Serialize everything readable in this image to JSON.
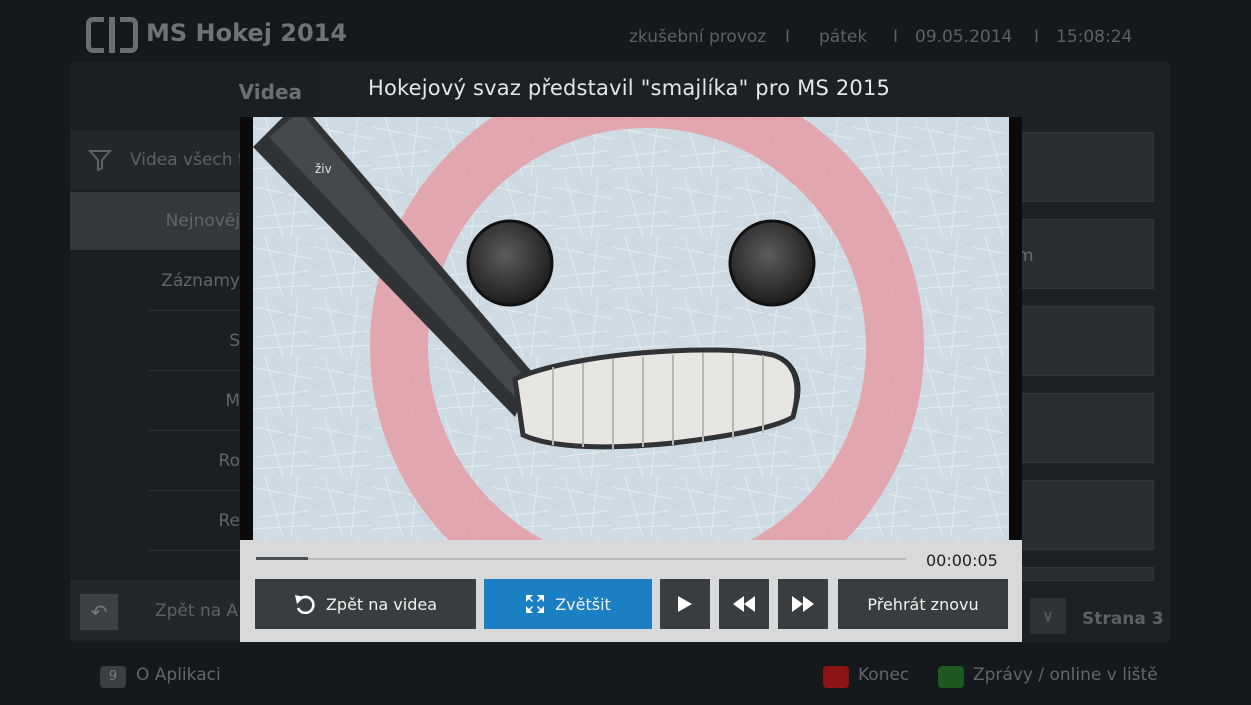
{
  "header": {
    "app_title": "MS Hokej 2014",
    "mode": "zkušební provoz",
    "separator": "I",
    "day": "pátek",
    "date": "09.05.2014",
    "time": "15:08:24"
  },
  "sidebar": {
    "title": "Videa",
    "filter_label": "Videa všech t",
    "items": [
      {
        "label": "Nejnověj"
      },
      {
        "label": "Záznamy"
      },
      {
        "label": "S"
      },
      {
        "label": "M"
      },
      {
        "label": "Ro"
      },
      {
        "label": "Re"
      }
    ],
    "back_label": "Zpět na A"
  },
  "list": {
    "partial_text": "m",
    "page_label": "Strana 3"
  },
  "footer": {
    "app_key": "9",
    "about_label": "O Aplikaci",
    "exit_label": "Konec",
    "news_label": "Zprávy / online v liště",
    "exit_color": "#8b1414",
    "news_color": "#1c5a22"
  },
  "video_modal": {
    "title": "Hokejový svaz představil \"smajlíka\" pro MS 2015",
    "elapsed": "00:00:05",
    "progress": 0.08,
    "overlay_text": "živ",
    "buttons": {
      "back_to_videos": "Zpět na videa",
      "enlarge": "Zvětšit",
      "replay": "Přehrát znovu"
    },
    "icons": {
      "back": "undo-arrow-icon",
      "enlarge": "expand-icon",
      "play": "play-icon",
      "rewind": "rewind-icon",
      "forward": "fast-forward-icon"
    },
    "accent_color": "#1b7fc3"
  }
}
